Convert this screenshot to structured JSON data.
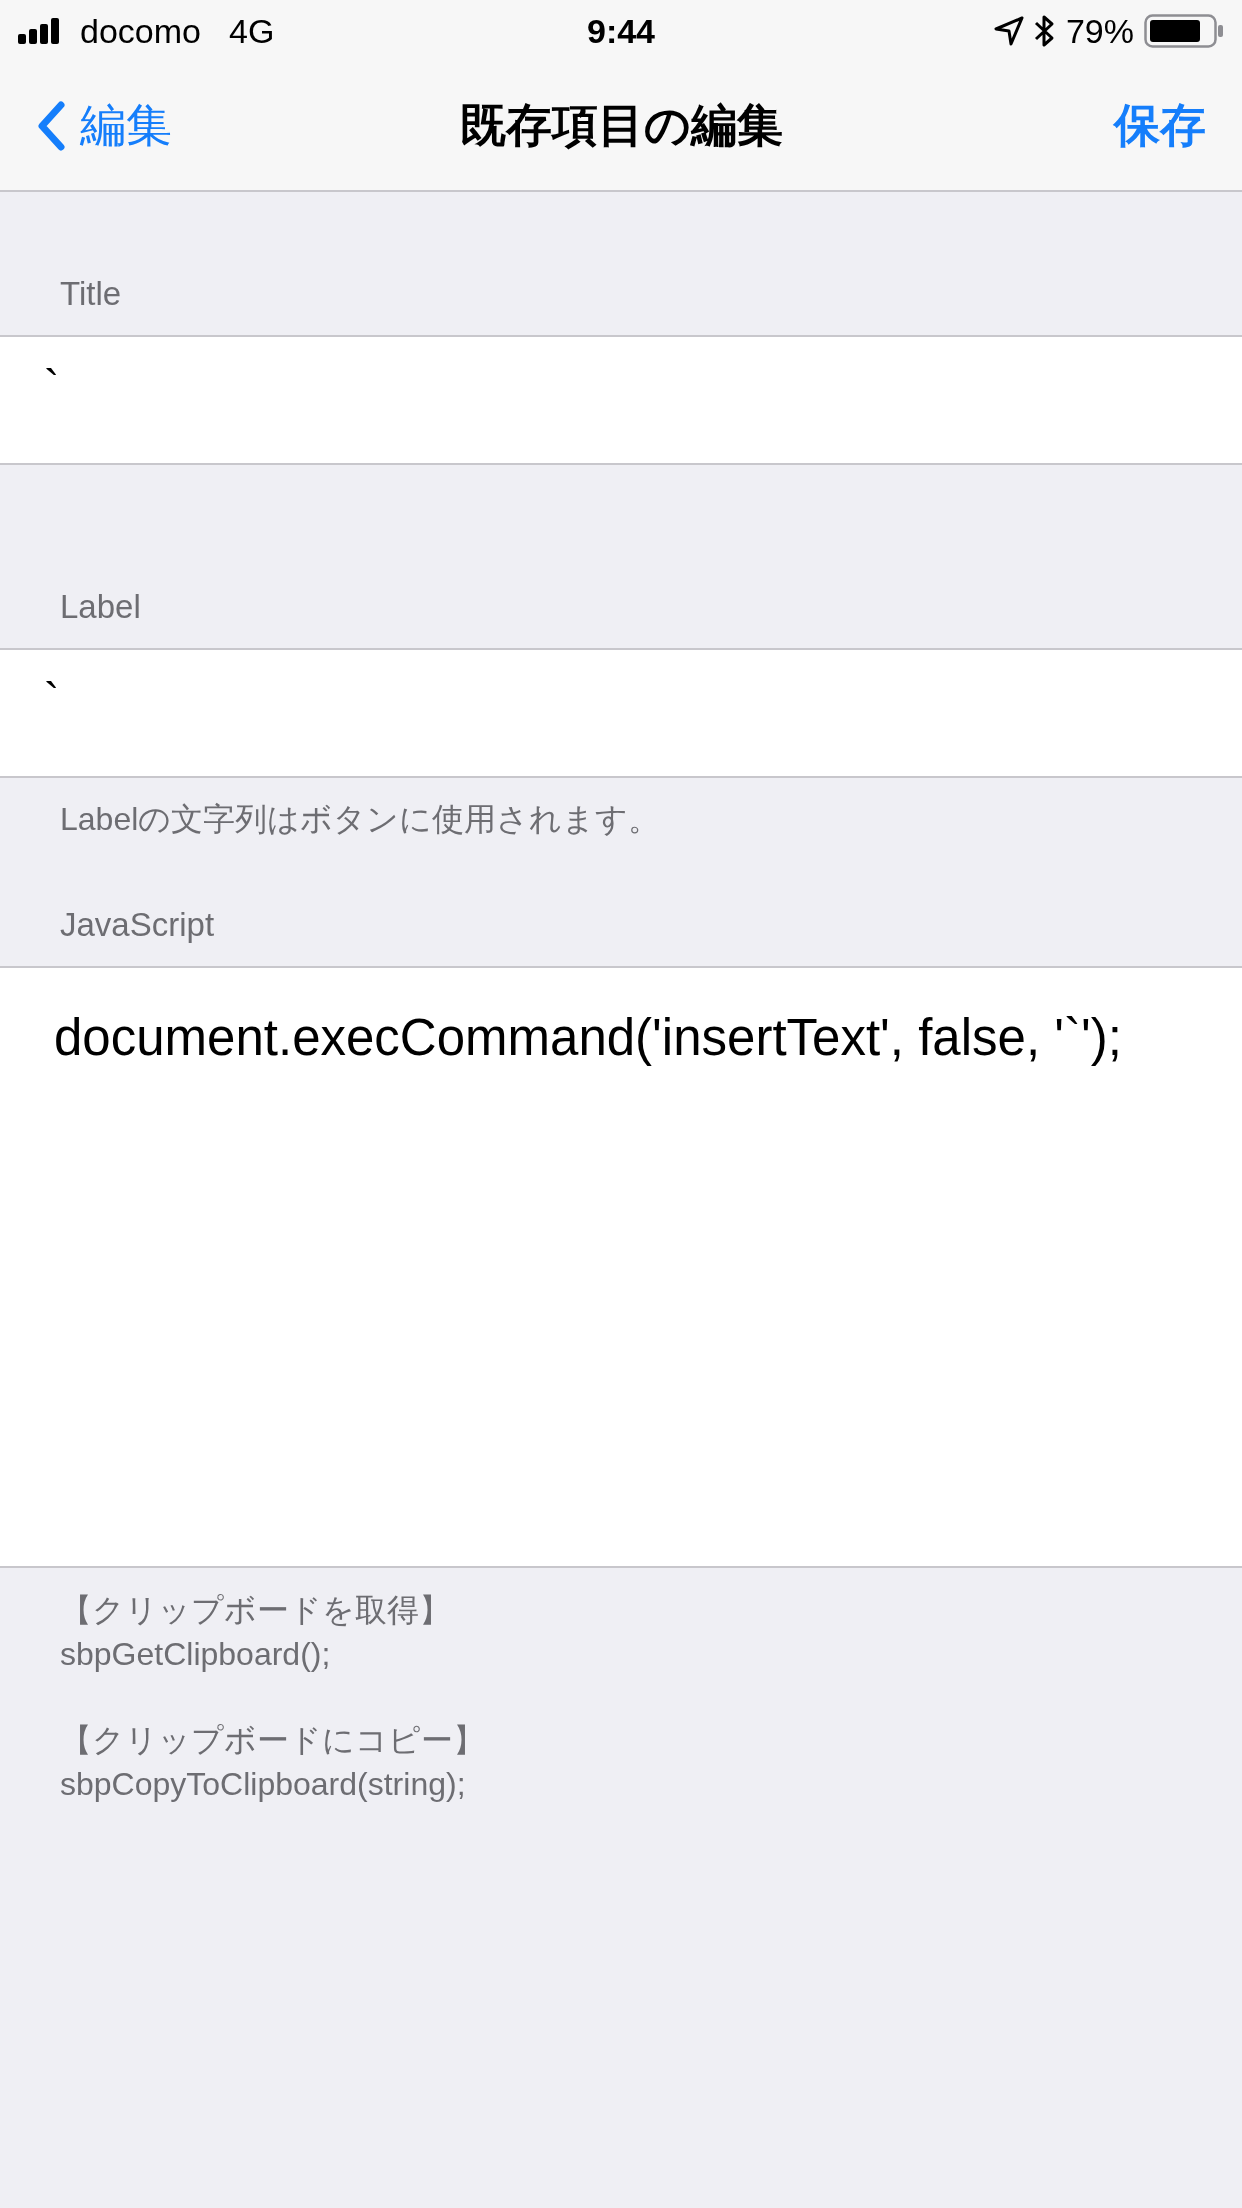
{
  "status_bar": {
    "carrier": "docomo",
    "network": "4G",
    "time": "9:44",
    "battery": "79%"
  },
  "nav_bar": {
    "back": "編集",
    "title": "既存項目の編集",
    "action": "保存"
  },
  "sections": [
    {
      "header": "Title",
      "value": "`"
    },
    {
      "header": "Label",
      "value": "`",
      "footer": "Labelの文字列はボタンに使用されます。"
    }
  ],
  "script": {
    "header": "JavaScript",
    "value": "document.execCommand('insertText', false, '`');"
  },
  "notes": [
    {
      "heading": "【クリップボードを取得】",
      "code": "sbpGetClipboard();"
    },
    {
      "heading": "【クリップボードにコピー】",
      "code": "sbpCopyToClipboard(string);"
    }
  ]
}
